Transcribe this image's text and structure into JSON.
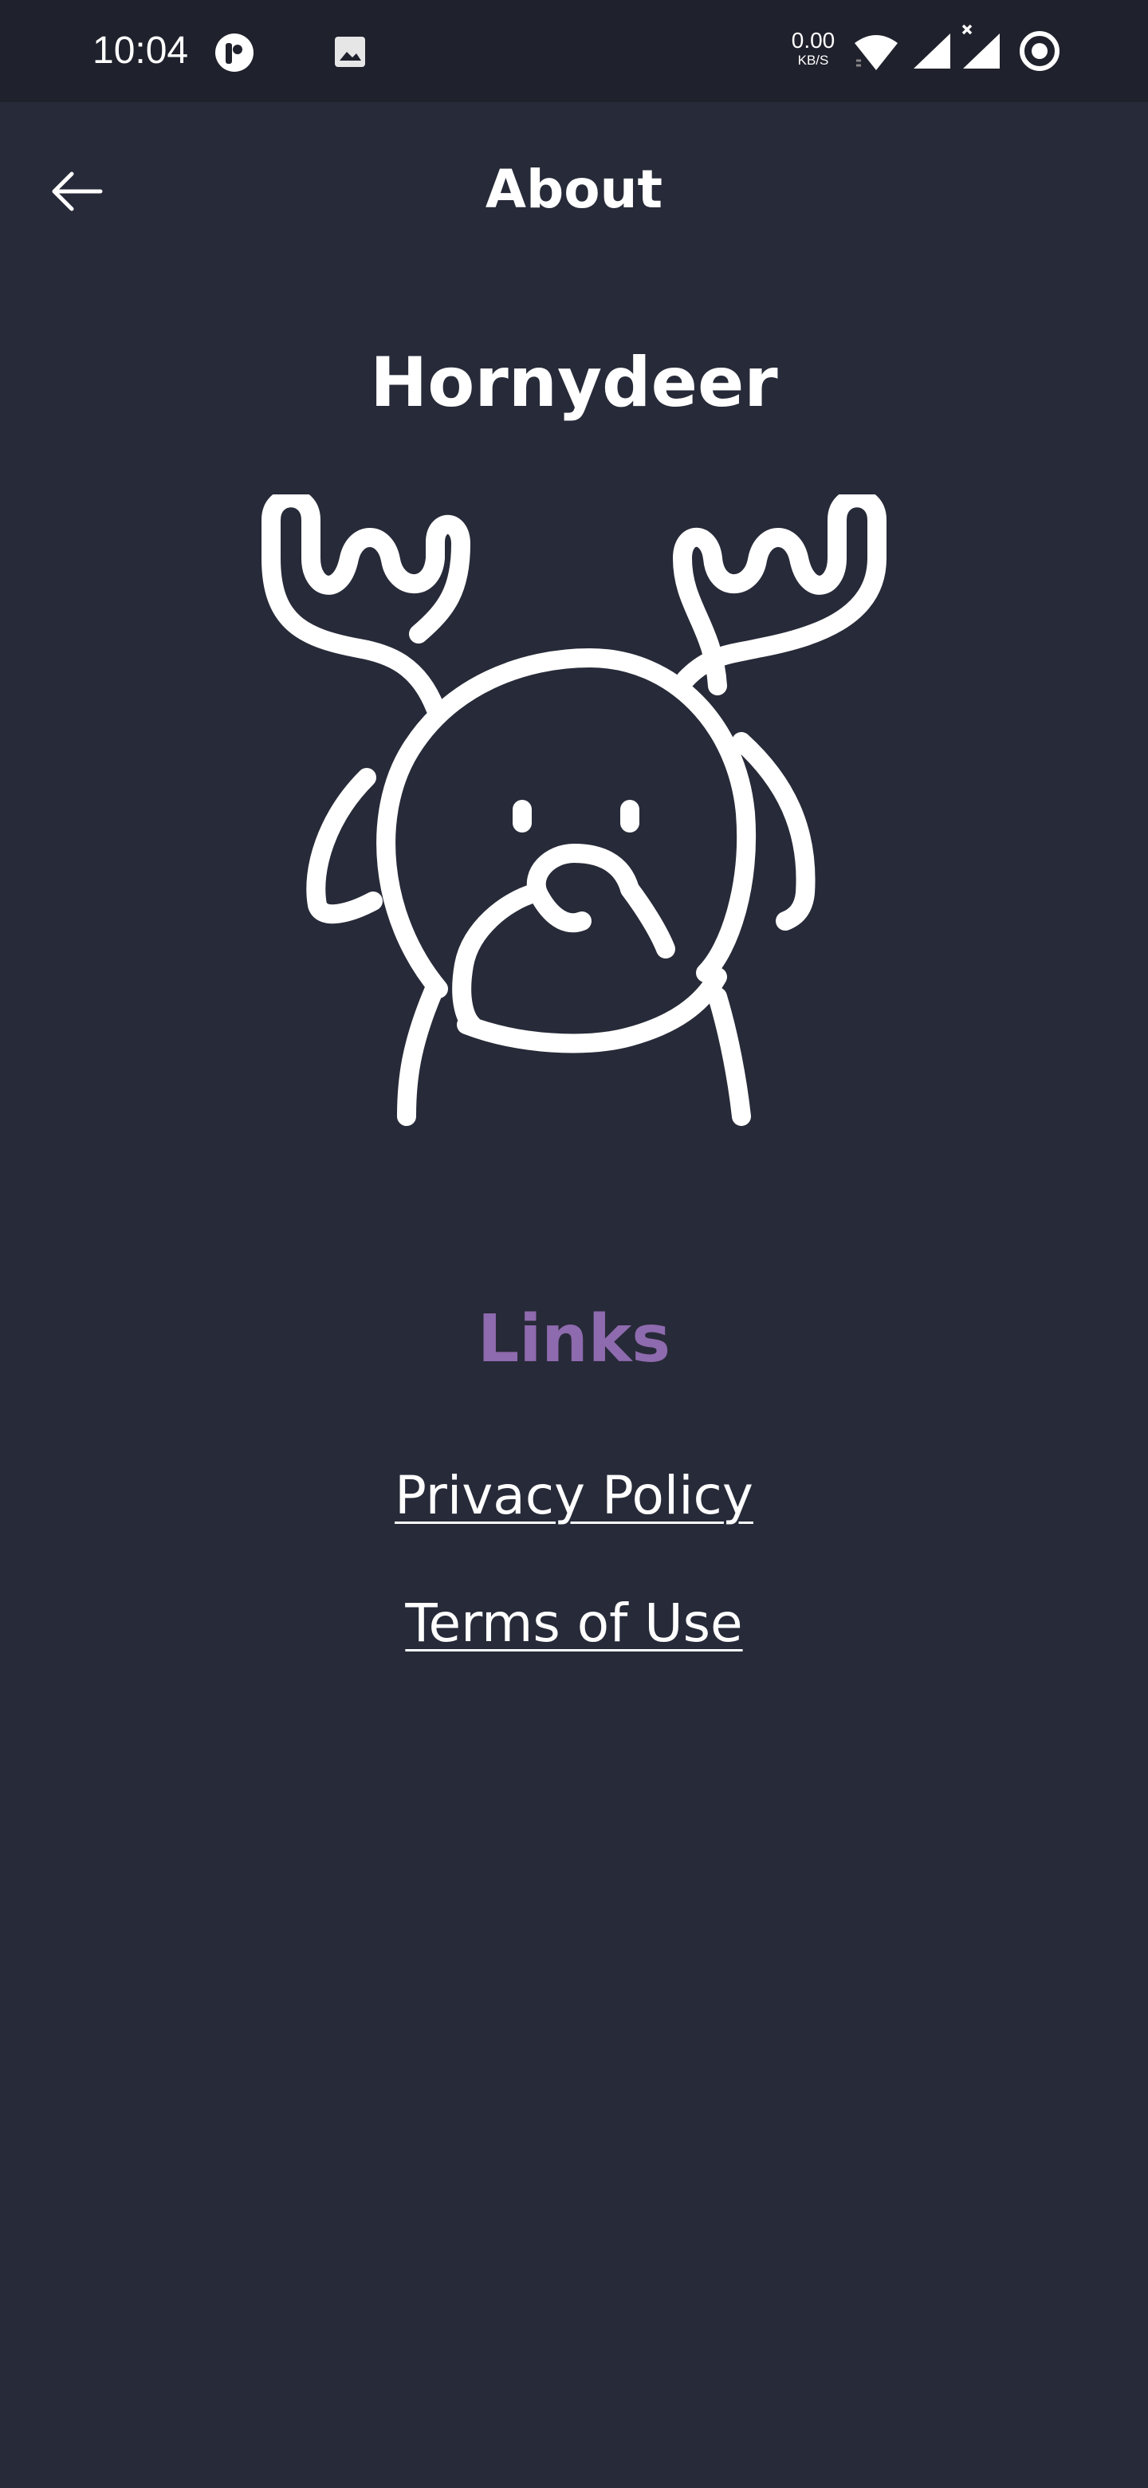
{
  "status_bar": {
    "time": "10:04",
    "net_speed_value": "0.00",
    "net_speed_unit": "KB/S",
    "icons": [
      "app-notification-icon",
      "image-notification-icon",
      "wifi-icon",
      "signal-icon",
      "signal-no-data-icon",
      "ring-status-icon"
    ]
  },
  "header": {
    "back_icon": "arrow-left-icon",
    "title": "About"
  },
  "app": {
    "name": "Hornydeer",
    "logo_icon": "deer-logo-icon"
  },
  "links": {
    "heading": "Links",
    "heading_color": "#8e6aae",
    "items": [
      {
        "label": "Privacy Policy"
      },
      {
        "label": "Terms of Use"
      }
    ]
  },
  "colors": {
    "background": "#272a38",
    "status_bar": "#1f212c",
    "text": "#ffffff",
    "accent": "#8e6aae"
  }
}
